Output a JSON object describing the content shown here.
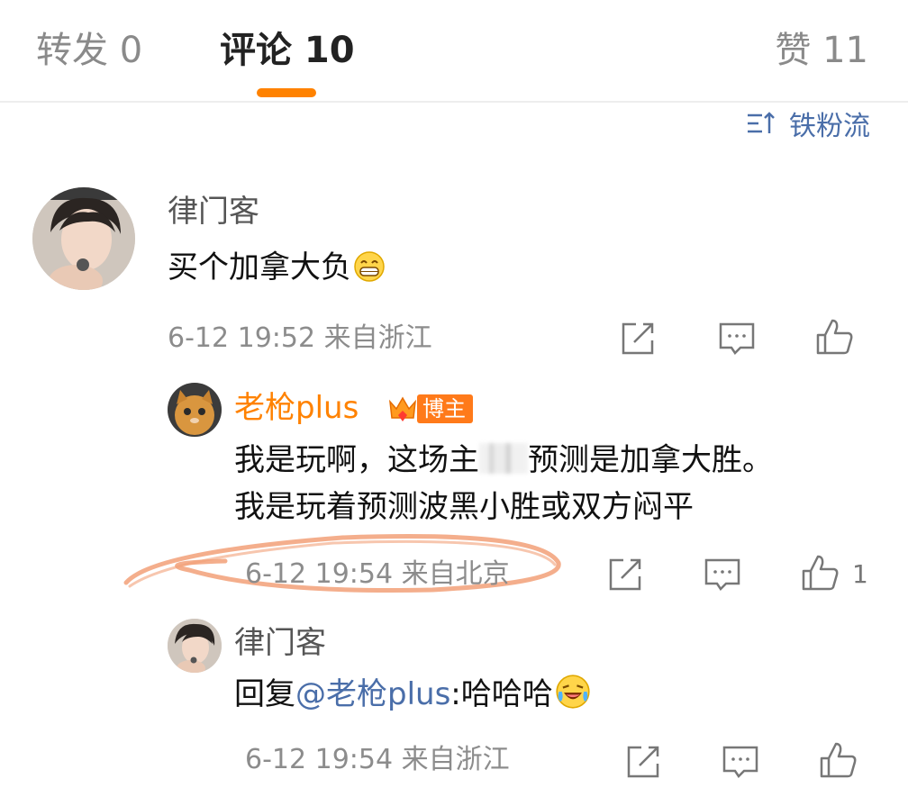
{
  "tabs": {
    "repost": "转发 0",
    "comments": "评论 10",
    "likes": "赞 11"
  },
  "sort_label": "铁粉流",
  "colors": {
    "accent": "#ff8200",
    "link": "#4a6ea9",
    "badge": "#ff7a1a",
    "annotation": "#f2a078"
  },
  "comments": [
    {
      "user": "律门客",
      "text": "买个加拿大负",
      "emoji": "grin-emoji",
      "meta": "6-12 19:52 来自浙江",
      "likes": ""
    },
    {
      "user": "老枪plus",
      "badge": "博主",
      "text_line1_a": "我是玩啊，这场主",
      "text_line1_b": "预测是加拿大胜。",
      "text_line2": "我是玩着预测波黑小胜或双方闷平",
      "meta": "6-12 19:54 来自北京",
      "likes": "1"
    },
    {
      "user": "律门客",
      "reply_prefix": "回复",
      "mention": "@老枪plus",
      "reply_text": ":哈哈哈",
      "emoji": "laugh-cry-emoji",
      "meta": "6-12 19:54 来自浙江",
      "likes": ""
    }
  ]
}
